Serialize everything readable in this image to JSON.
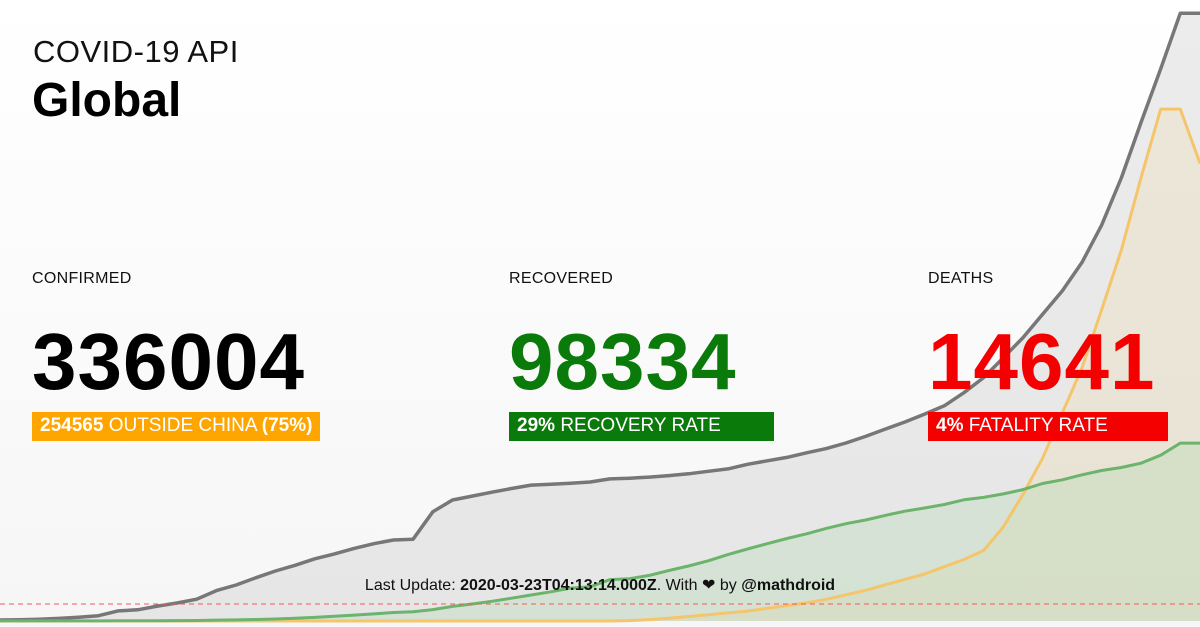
{
  "header": {
    "app_title": "COVID-19 API",
    "region": "Global"
  },
  "stats": {
    "confirmed": {
      "label": "CONFIRMED",
      "value": "336004",
      "outside_china": "254565",
      "outside_text": "OUTSIDE CHINA",
      "outside_pct": "(75%)"
    },
    "recovered": {
      "label": "RECOVERED",
      "value": "98334",
      "rate": "29%",
      "rate_text": "RECOVERY RATE"
    },
    "deaths": {
      "label": "DEATHS",
      "value": "14641",
      "rate": "4%",
      "rate_text": "FATALITY RATE"
    }
  },
  "footer": {
    "prefix": "Last Update:",
    "timestamp": "2020-03-23T04:13:14.000Z",
    "with_text": ". With",
    "heart": "❤",
    "by_text": "by",
    "author": "@mathdroid"
  },
  "colors": {
    "confirmed": "#000000",
    "recovered": "#0a7a0a",
    "deaths": "#f50000",
    "outside_china_badge": "#ffa500",
    "confirmed_line": "#777777",
    "recovered_line": "#6cb36c",
    "deaths_line": "#f4c56a",
    "baseline": "#f25a5a"
  },
  "chart_data": {
    "type": "area",
    "title": "",
    "xlabel": "",
    "ylabel": "",
    "grid": false,
    "legend": "none",
    "ylim": [
      0,
      340000
    ],
    "series": [
      {
        "key": "confirmed",
        "values": [
          555,
          653,
          941,
          1434,
          2118,
          2927,
          5578,
          6166,
          8234,
          9927,
          12038,
          16787,
          19881,
          23892,
          27635,
          30794,
          34391,
          37120,
          40150,
          42762,
          44802,
          45221,
          60368,
          66885,
          69030,
          71224,
          73258,
          75136,
          75639,
          76197,
          76819,
          78572,
          78958,
          79561,
          80406,
          81388,
          82746,
          84112,
          86604,
          88585,
          90443,
          93016,
          95314,
          98425,
          102050,
          106099,
          109991,
          114381,
          118948,
          126214,
          134576,
          145483,
          156653,
          169593,
          182490,
          198234,
          218822,
          244933,
          275597,
          305275,
          336004,
          336004
        ]
      },
      {
        "key": "deaths_line_top",
        "values": [
          0,
          0,
          0,
          0,
          0,
          0,
          0,
          0,
          0,
          0,
          0,
          0,
          0,
          0,
          0,
          0,
          0,
          0,
          0,
          0,
          0,
          0,
          0,
          0,
          0,
          0,
          0,
          0,
          0,
          0,
          0,
          0,
          200,
          800,
          1500,
          2500,
          3500,
          4500,
          5500,
          7000,
          8500,
          10000,
          12000,
          14500,
          17000,
          20000,
          23000,
          26000,
          30000,
          34000,
          39000,
          52000,
          70000,
          90000,
          115000,
          140000,
          172000,
          205000,
          245000,
          283000,
          283000,
          253000
        ]
      },
      {
        "key": "recovered",
        "values": [
          28,
          30,
          36,
          39,
          52,
          61,
          107,
          126,
          143,
          222,
          284,
          472,
          623,
          852,
          1124,
          1487,
          2011,
          2616,
          3244,
          3946,
          4683,
          5150,
          6295,
          8058,
          9395,
          10865,
          12583,
          14352,
          16121,
          18177,
          18890,
          22886,
          23394,
          25227,
          27905,
          30384,
          33277,
          36711,
          39782,
          42716,
          45602,
          48228,
          51170,
          53796,
          55865,
          58359,
          60694,
          62494,
          64404,
          67003,
          68324,
          70251,
          72624,
          76034,
          78088,
          80840,
          83207,
          84854,
          87256,
          91682,
          98334,
          98334
        ]
      }
    ]
  }
}
